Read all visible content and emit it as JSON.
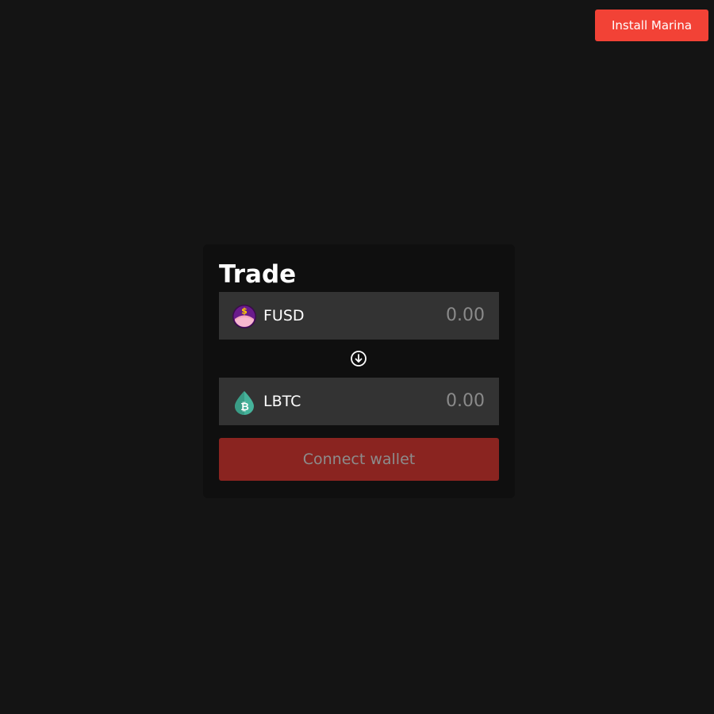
{
  "header": {
    "install_label": "Install Marina"
  },
  "trade": {
    "title": "Trade",
    "from": {
      "ticker": "FUSD",
      "icon": "fusd-token-icon",
      "amount_placeholder": "0.00"
    },
    "swap_icon": "arrow-down-circle-icon",
    "to": {
      "ticker": "LBTC",
      "icon": "lbtc-token-icon",
      "amount_placeholder": "0.00"
    },
    "connect_label": "Connect wallet"
  },
  "colors": {
    "background": "#141414",
    "card": "#0f0f0f",
    "row": "#333333",
    "install_button": "#f24236",
    "connect_button": "#8a2420"
  }
}
